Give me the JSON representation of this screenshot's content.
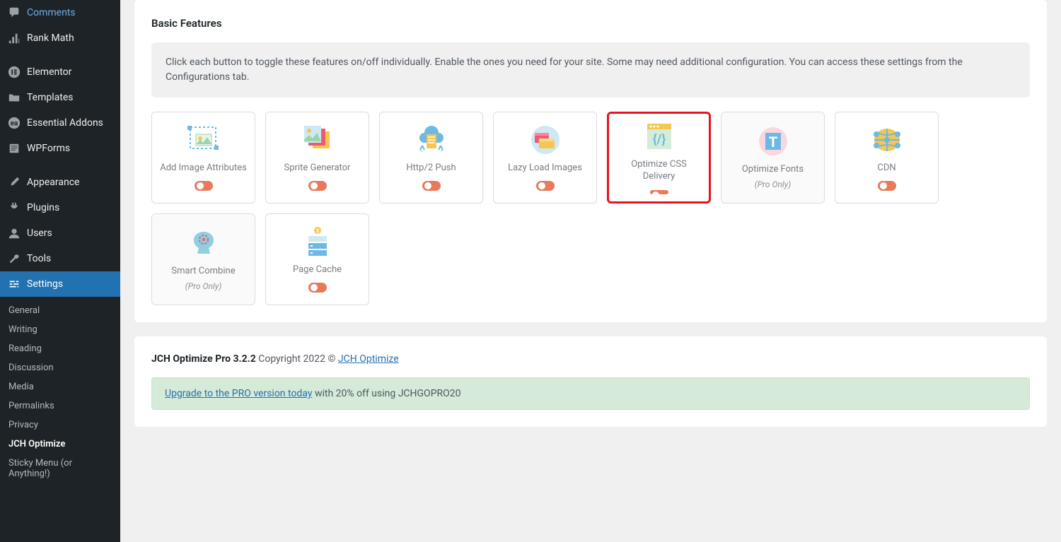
{
  "sidebar": {
    "items": [
      {
        "label": "Comments",
        "active": false
      },
      {
        "label": "Rank Math",
        "active": false
      },
      {
        "label": "Elementor",
        "active": false
      },
      {
        "label": "Templates",
        "active": false
      },
      {
        "label": "Essential Addons",
        "active": false
      },
      {
        "label": "WPForms",
        "active": false
      },
      {
        "label": "Appearance",
        "active": false
      },
      {
        "label": "Plugins",
        "active": false
      },
      {
        "label": "Users",
        "active": false
      },
      {
        "label": "Tools",
        "active": false
      },
      {
        "label": "Settings",
        "active": true
      }
    ],
    "sub_items": [
      {
        "label": "General",
        "current": false
      },
      {
        "label": "Writing",
        "current": false
      },
      {
        "label": "Reading",
        "current": false
      },
      {
        "label": "Discussion",
        "current": false
      },
      {
        "label": "Media",
        "current": false
      },
      {
        "label": "Permalinks",
        "current": false
      },
      {
        "label": "Privacy",
        "current": false
      },
      {
        "label": "JCH Optimize",
        "current": true
      },
      {
        "label": "Sticky Menu (or Anything!)",
        "current": false
      }
    ]
  },
  "section_title": "Basic Features",
  "info_text": "Click each button to toggle these features on/off individually. Enable the ones you need for your site. Some may need additional configuration. You can access these settings from the Configurations tab.",
  "features": [
    {
      "label": "Add Image Attributes",
      "pro": false,
      "highlighted": false,
      "has_toggle": true
    },
    {
      "label": "Sprite Generator",
      "pro": false,
      "highlighted": false,
      "has_toggle": true
    },
    {
      "label": "Http/2 Push",
      "pro": false,
      "highlighted": false,
      "has_toggle": true
    },
    {
      "label": "Lazy Load Images",
      "pro": false,
      "highlighted": false,
      "has_toggle": true
    },
    {
      "label": "Optimize CSS Delivery",
      "pro": false,
      "highlighted": true,
      "has_toggle": true
    },
    {
      "label": "Optimize Fonts",
      "pro": true,
      "highlighted": false,
      "has_toggle": false
    },
    {
      "label": "CDN",
      "pro": false,
      "highlighted": false,
      "has_toggle": true
    },
    {
      "label": "Smart Combine",
      "pro": true,
      "highlighted": false,
      "has_toggle": false
    },
    {
      "label": "Page Cache",
      "pro": false,
      "highlighted": false,
      "has_toggle": true
    }
  ],
  "pro_only_label": "(Pro Only)",
  "footer": {
    "product": "JCH Optimize Pro 3.2.2",
    "copyright": " Copyright 2022 © ",
    "link_text": "JCH Optimize",
    "upgrade_link": "Upgrade to the PRO version today",
    "upgrade_rest": " with 20% off using JCHGOPRO20"
  }
}
